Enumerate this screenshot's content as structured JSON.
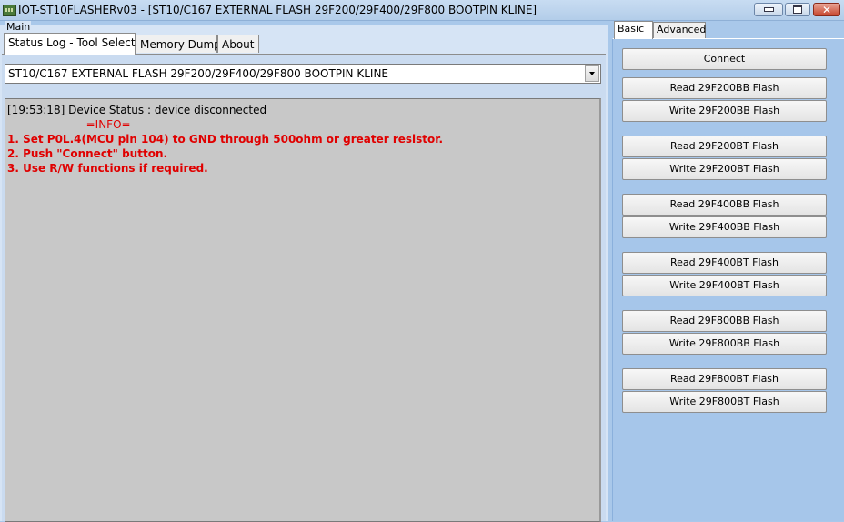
{
  "window": {
    "title": "IOT-ST10FLASHERv03 - [ST10/C167 EXTERNAL FLASH 29F200/29F400/29F800 BOOTPIN KLINE]"
  },
  "main": {
    "group_label": "Main",
    "tabs": [
      "Status Log - Tool Select",
      "Memory Dump",
      "About"
    ],
    "selected_tool": "ST10/C167 EXTERNAL FLASH 29F200/29F400/29F800 BOOTPIN KLINE",
    "log": {
      "status": "[19:53:18] Device Status : device disconnected",
      "info_separator": "--------------------=INFO=--------------------",
      "steps": [
        "1. Set P0L.4(MCU pin 104) to GND through 500ohm or greater resistor.",
        "2. Push \"Connect\" button.",
        "3. Use R/W functions if required."
      ]
    }
  },
  "right": {
    "tabs": [
      "Basic",
      "Advanced"
    ],
    "connect_label": "Connect",
    "buttons": [
      "Read 29F200BB Flash",
      "Write 29F200BB Flash",
      "Read 29F200BT Flash",
      "Write 29F200BT Flash",
      "Read 29F400BB Flash",
      "Write 29F400BB Flash",
      "Read 29F400BT Flash",
      "Write 29F400BT Flash",
      "Read 29F800BB Flash",
      "Write 29F800BB Flash",
      "Read 29F800BT Flash",
      "Write 29F800BT Flash"
    ]
  },
  "icons": {
    "app": "app-chip-icon",
    "minimize": "minimize-icon",
    "maximize": "maximize-icon",
    "close": "close-icon",
    "dropdown": "chevron-down-icon"
  },
  "colors": {
    "log_highlight": "#e00000",
    "log_background": "#c8c8c8",
    "panel_blue": "#a6c6ea"
  }
}
